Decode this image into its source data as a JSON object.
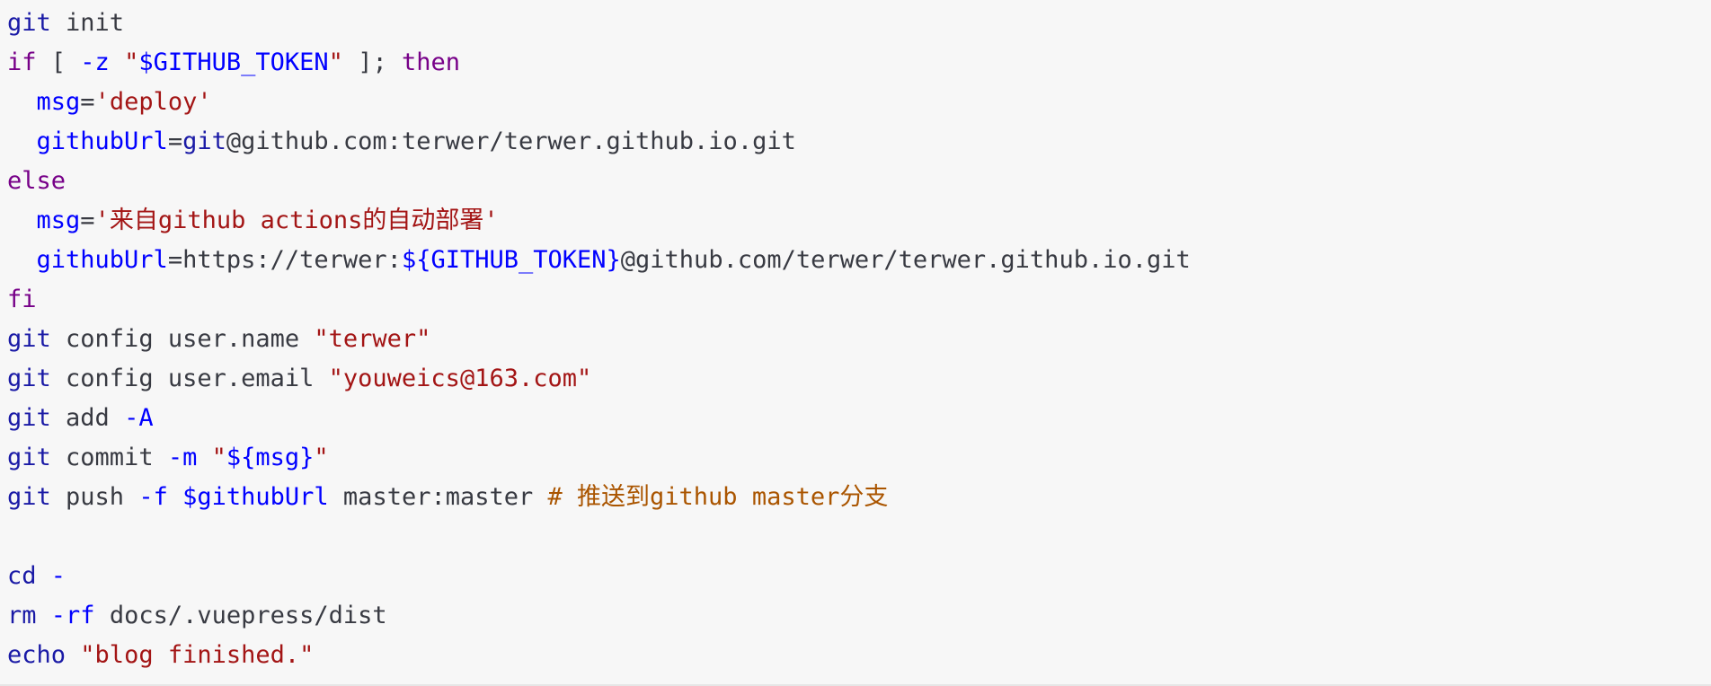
{
  "colors": {
    "background": "#f7f7f7",
    "command": "#1a1aa6",
    "keyword": "#770088",
    "variable": "#0000ff",
    "string": "#a31515",
    "comment": "#aa5500",
    "text": "#383a42"
  },
  "code": {
    "language": "bash",
    "lines": [
      [
        {
          "t": "cmd",
          "v": "git"
        },
        {
          "t": "txt",
          "v": " init"
        }
      ],
      [
        {
          "t": "kw",
          "v": "if"
        },
        {
          "t": "txt",
          "v": " [ "
        },
        {
          "t": "var",
          "v": "-z"
        },
        {
          "t": "txt",
          "v": " "
        },
        {
          "t": "str",
          "v": "\""
        },
        {
          "t": "var",
          "v": "$GITHUB_TOKEN"
        },
        {
          "t": "str",
          "v": "\""
        },
        {
          "t": "txt",
          "v": " ]; "
        },
        {
          "t": "kw",
          "v": "then"
        }
      ],
      [
        {
          "t": "txt",
          "v": "  "
        },
        {
          "t": "var",
          "v": "msg"
        },
        {
          "t": "op",
          "v": "="
        },
        {
          "t": "str",
          "v": "'deploy'"
        }
      ],
      [
        {
          "t": "txt",
          "v": "  "
        },
        {
          "t": "var",
          "v": "githubUrl"
        },
        {
          "t": "op",
          "v": "="
        },
        {
          "t": "cmd",
          "v": "git"
        },
        {
          "t": "txt",
          "v": "@github.com:terwer/terwer.github.io.git"
        }
      ],
      [
        {
          "t": "kw",
          "v": "else"
        }
      ],
      [
        {
          "t": "txt",
          "v": "  "
        },
        {
          "t": "var",
          "v": "msg"
        },
        {
          "t": "op",
          "v": "="
        },
        {
          "t": "str",
          "v": "'来自github actions的自动部署'"
        }
      ],
      [
        {
          "t": "txt",
          "v": "  "
        },
        {
          "t": "var",
          "v": "githubUrl"
        },
        {
          "t": "op",
          "v": "="
        },
        {
          "t": "txt",
          "v": "https://terwer:"
        },
        {
          "t": "var",
          "v": "${GITHUB_TOKEN}"
        },
        {
          "t": "txt",
          "v": "@github.com/terwer/terwer.github.io.git"
        }
      ],
      [
        {
          "t": "kw",
          "v": "fi"
        }
      ],
      [
        {
          "t": "cmd",
          "v": "git"
        },
        {
          "t": "txt",
          "v": " config user.name "
        },
        {
          "t": "str",
          "v": "\"terwer\""
        }
      ],
      [
        {
          "t": "cmd",
          "v": "git"
        },
        {
          "t": "txt",
          "v": " config user.email "
        },
        {
          "t": "str",
          "v": "\"youweics@163.com\""
        }
      ],
      [
        {
          "t": "cmd",
          "v": "git"
        },
        {
          "t": "txt",
          "v": " add "
        },
        {
          "t": "var",
          "v": "-A"
        }
      ],
      [
        {
          "t": "cmd",
          "v": "git"
        },
        {
          "t": "txt",
          "v": " commit "
        },
        {
          "t": "var",
          "v": "-m"
        },
        {
          "t": "txt",
          "v": " "
        },
        {
          "t": "str",
          "v": "\""
        },
        {
          "t": "var",
          "v": "${msg}"
        },
        {
          "t": "str",
          "v": "\""
        }
      ],
      [
        {
          "t": "cmd",
          "v": "git"
        },
        {
          "t": "txt",
          "v": " push "
        },
        {
          "t": "var",
          "v": "-f"
        },
        {
          "t": "txt",
          "v": " "
        },
        {
          "t": "var",
          "v": "$githubUrl"
        },
        {
          "t": "txt",
          "v": " master:master "
        },
        {
          "t": "cmt",
          "v": "# 推送到github master分支"
        }
      ],
      [],
      [
        {
          "t": "cmd",
          "v": "cd"
        },
        {
          "t": "txt",
          "v": " "
        },
        {
          "t": "var",
          "v": "-"
        }
      ],
      [
        {
          "t": "cmd",
          "v": "rm"
        },
        {
          "t": "txt",
          "v": " "
        },
        {
          "t": "var",
          "v": "-rf"
        },
        {
          "t": "txt",
          "v": " docs/.vuepress/dist"
        }
      ],
      [
        {
          "t": "cmd",
          "v": "echo"
        },
        {
          "t": "txt",
          "v": " "
        },
        {
          "t": "str",
          "v": "\"blog finished.\""
        }
      ]
    ]
  }
}
